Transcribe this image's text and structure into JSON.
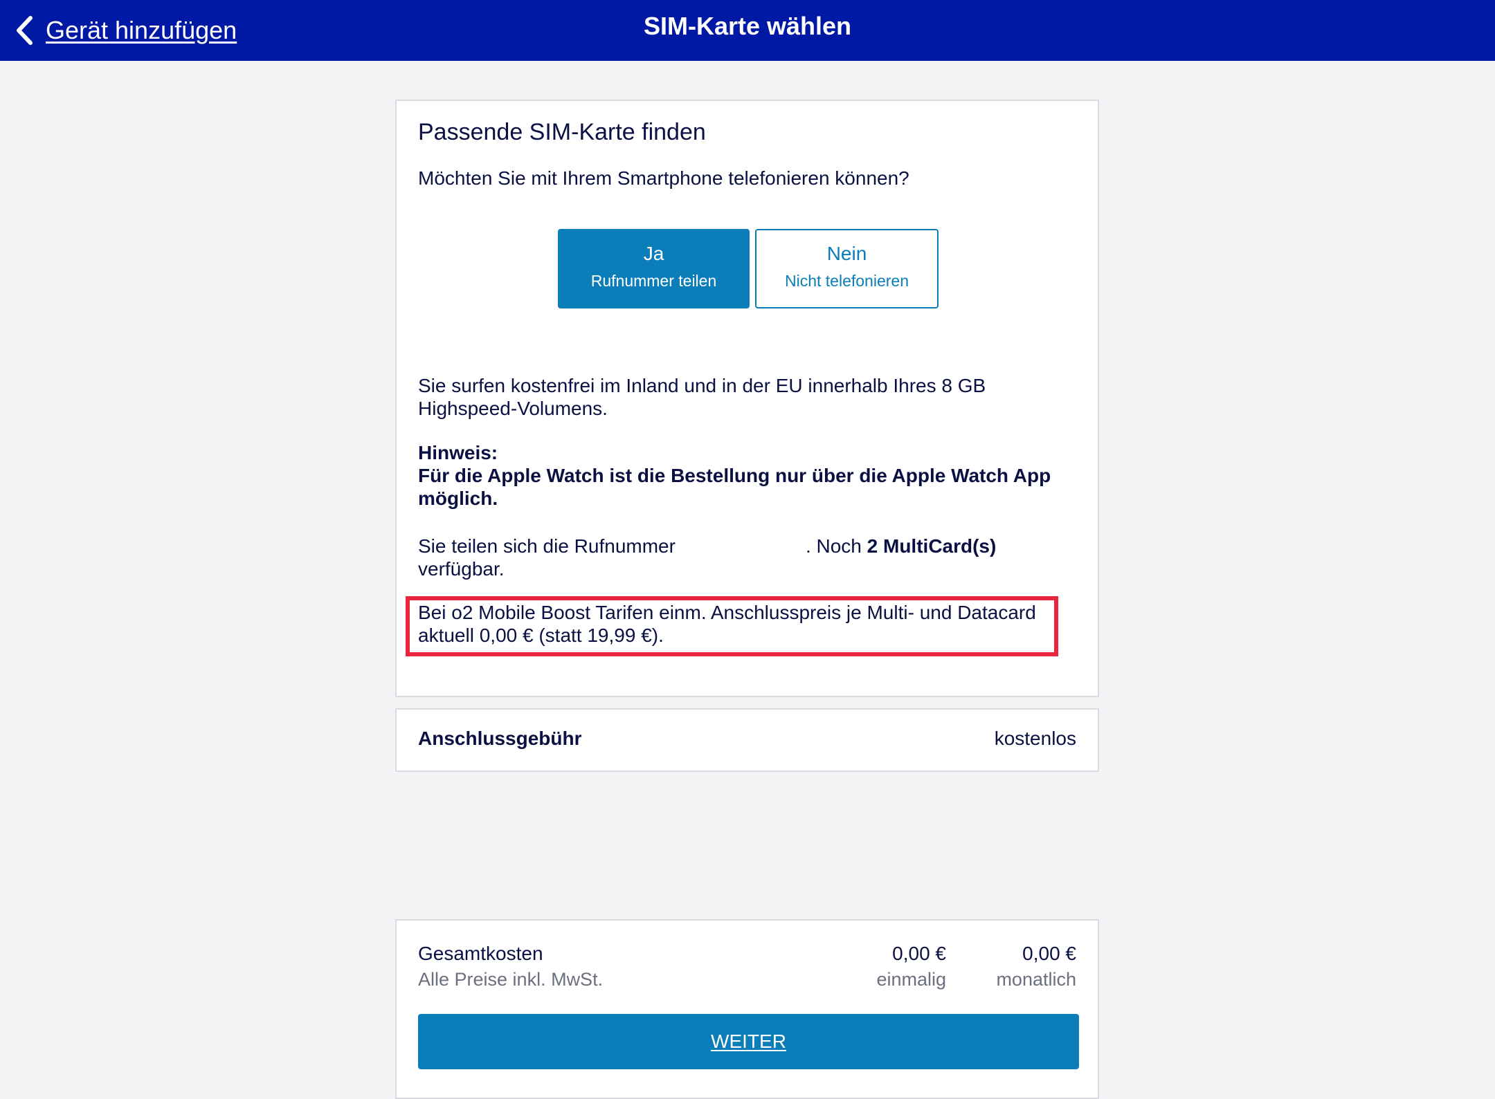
{
  "header": {
    "back_label": "Gerät hinzufügen",
    "title": "SIM-Karte wählen"
  },
  "sim_finder": {
    "heading": "Passende SIM-Karte finden",
    "question": "Möchten Sie mit Ihrem Smartphone telefonieren können?",
    "options": [
      {
        "label": "Ja",
        "sublabel": "Rufnummer teilen",
        "selected": true
      },
      {
        "label": "Nein",
        "sublabel": "Nicht telefonieren",
        "selected": false
      }
    ],
    "surf_info": "Sie surfen kostenfrei im Inland und in der EU innerhalb Ihres 8 GB Highspeed-Volumens.",
    "hint_title": "Hinweis:",
    "hint_text": "Für die Apple Watch ist die Bestellung nur über die Apple Watch App möglich.",
    "share_prefix": "Sie teilen sich die Rufnummer",
    "share_middle": ". Noch ",
    "share_count": "2 MultiCard(s)",
    "share_suffix": " verfügbar.",
    "boost_note": "Bei o2 Mobile Boost Tarifen einm. Anschlusspreis je Multi- und Datacard aktuell 0,00 € (statt 19,99 €).",
    "highlight_color": "#e8243e"
  },
  "fee": {
    "label": "Anschlussgebühr",
    "value": "kostenlos"
  },
  "totals": {
    "label": "Gesamtkosten",
    "sublabel": "Alle Preise inkl. MwSt.",
    "once_value": "0,00 €",
    "once_label": "einmalig",
    "monthly_value": "0,00 €",
    "monthly_label": "monatlich",
    "continue_label": "WEITER"
  },
  "colors": {
    "navbar": "#0019a5",
    "accent": "#0b7db8",
    "background": "#f3f4f6",
    "text": "#0a1042"
  }
}
